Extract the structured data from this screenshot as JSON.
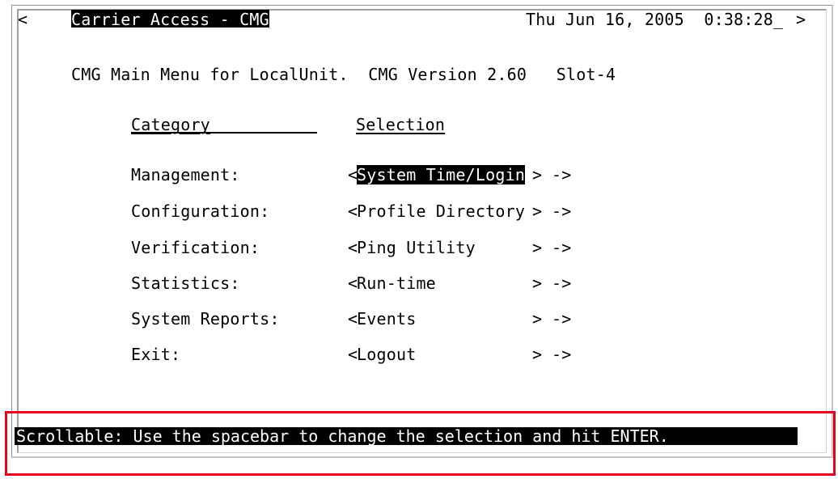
{
  "header": {
    "left_arrow": "<",
    "app_title": "Carrier Access - CMG",
    "datetime": "Thu Jun 16, 2005  0:38:28_",
    "right_arrow": ">"
  },
  "subtitle": "CMG Main Menu for LocalUnit.  CMG Version 2.60   Slot-4",
  "columns": {
    "category": "Category",
    "selection": "Selection"
  },
  "menu": [
    {
      "category": "Management:",
      "open": "<",
      "selection": "System Time/Login",
      "close": ">",
      "arrow": "->",
      "selected": true
    },
    {
      "category": "Configuration:",
      "open": "<",
      "selection": "Profile Directory",
      "close": ">",
      "arrow": "->",
      "selected": false
    },
    {
      "category": "Verification:",
      "open": "<",
      "selection": "Ping Utility",
      "close": ">",
      "arrow": "->",
      "selected": false
    },
    {
      "category": "Statistics:",
      "open": "<",
      "selection": "Run-time",
      "close": ">",
      "arrow": "->",
      "selected": false
    },
    {
      "category": "System Reports:",
      "open": "<",
      "selection": "Events",
      "close": ">",
      "arrow": "->",
      "selected": false
    },
    {
      "category": "Exit:",
      "open": "<",
      "selection": "Logout",
      "close": ">",
      "arrow": "->",
      "selected": false
    }
  ],
  "status_line": "Scrollable: Use the spacebar to change the selection and hit ENTER.",
  "colors": {
    "highlight_border": "#e8001c",
    "inverse_bg": "#000000",
    "inverse_fg": "#ffffff"
  }
}
